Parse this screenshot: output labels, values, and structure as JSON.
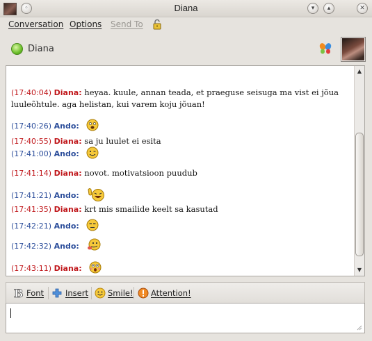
{
  "window": {
    "title": "Diana"
  },
  "menu": {
    "conversation": "Conversation",
    "options": "Options",
    "send_to": "Send To"
  },
  "contact": {
    "name": "Diana",
    "status": "online"
  },
  "messages": [
    {
      "time": "(17:40:04)",
      "nick": "Diana:",
      "sender": "diana",
      "text": "heyaa. kuule, annan teada, et praeguse seisuga ma vist ei jõua luuleõhtule. aga helistan, kui varem koju jõuan!"
    },
    {
      "time": "(17:40:26)",
      "nick": "Ando:",
      "sender": "ando",
      "text": "",
      "emoticon": "shocked-smiley-icon"
    },
    {
      "time": "(17:40:55)",
      "nick": "Diana:",
      "sender": "diana",
      "text": "sa ju luulet ei esita"
    },
    {
      "time": "(17:41:00)",
      "nick": "Ando:",
      "sender": "ando",
      "text": "",
      "emoticon": "wink-smiley-icon"
    },
    {
      "time": "(17:41:14)",
      "nick": "Diana:",
      "sender": "diana",
      "text": "novot. motivatsioon puudub"
    },
    {
      "time": "(17:41:21)",
      "nick": "Ando:",
      "sender": "ando",
      "text": "",
      "emoticon": "laughing-smiley-icon"
    },
    {
      "time": "(17:41:35)",
      "nick": "Diana:",
      "sender": "diana",
      "text": "krt mis smailide keelt sa kasutad"
    },
    {
      "time": "(17:42:21)",
      "nick": "Ando:",
      "sender": "ando",
      "text": "",
      "emoticon": "unamused-smiley-icon"
    },
    {
      "time": "(17:42:32)",
      "nick": "Ando:",
      "sender": "ando",
      "text": "",
      "emoticon": "tongue-smiley-icon"
    },
    {
      "time": "(17:43:11)",
      "nick": "Diana:",
      "sender": "diana",
      "text": "",
      "emoticon": "surprised-smiley-icon"
    }
  ],
  "toolbar": {
    "font": "Font",
    "insert": "Insert",
    "smile": "Smile!",
    "attention": "Attention!"
  },
  "input": {
    "value": ""
  },
  "colors": {
    "diana": "#c0171b",
    "ando": "#2c4e9b",
    "status_online": "#6cbf2a"
  }
}
